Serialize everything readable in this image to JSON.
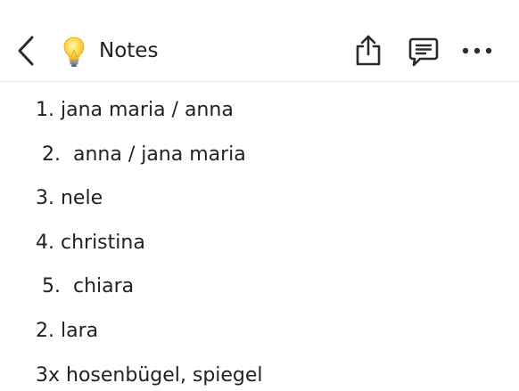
{
  "header": {
    "back_icon": "chevron-left-icon",
    "page_icon": "lightbulb-icon",
    "title": "Notes",
    "share_icon": "share-icon",
    "comment_icon": "comment-icon",
    "more_icon": "more-horizontal-icon"
  },
  "content": {
    "lines": [
      "1. jana maria / anna",
      " 2.  anna / jana maria",
      "3. nele",
      "4. christina",
      " 5.  chiara",
      "2. lara",
      "3x hosenbügel, spiegel"
    ]
  }
}
